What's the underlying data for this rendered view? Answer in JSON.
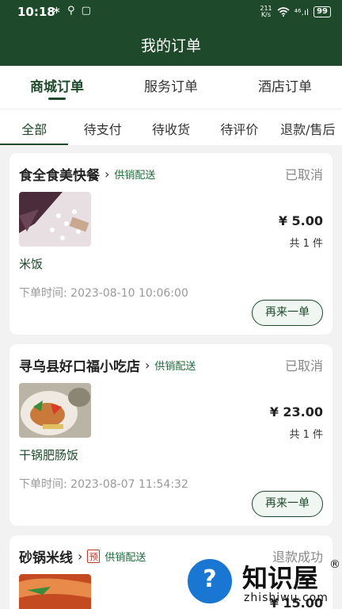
{
  "status_bar": {
    "time": "10:18",
    "left_icons": "∗ ⚲ ▢",
    "net_speed_top": "211",
    "net_speed_bottom": "K/s",
    "signal": "⁴⁶.ıl",
    "battery": "99"
  },
  "header": {
    "title": "我的订单"
  },
  "tabs": [
    {
      "label": "商城订单",
      "active": true
    },
    {
      "label": "服务订单",
      "active": false
    },
    {
      "label": "酒店订单",
      "active": false
    }
  ],
  "filters": [
    {
      "label": "全部",
      "active": true
    },
    {
      "label": "待支付",
      "active": false
    },
    {
      "label": "待收货",
      "active": false
    },
    {
      "label": "待评价",
      "active": false
    },
    {
      "label": "退款/售后",
      "active": false
    }
  ],
  "orders": [
    {
      "shop": "食全食美快餐",
      "chevron": "›",
      "pre_tag": "",
      "delivery": "供销配送",
      "status": "已取消",
      "item_name": "米饭",
      "price": "¥ 5.00",
      "count": "共 1 件",
      "time": "下单时间: 2023-08-10 10:06:00",
      "button": "再来一单"
    },
    {
      "shop": "寻乌县好口福小吃店",
      "chevron": "›",
      "pre_tag": "",
      "delivery": "供销配送",
      "status": "已取消",
      "item_name": "干锅肥肠饭",
      "price": "¥ 23.00",
      "count": "共 1 件",
      "time": "下单时间: 2023-08-07 11:54:32",
      "button": "再来一单"
    },
    {
      "shop": "砂锅米线",
      "chevron": "›",
      "pre_tag": "预",
      "delivery": "供销配送",
      "status": "退款成功",
      "price": "¥ 15.00"
    }
  ],
  "watermark": {
    "brand": "知识屋",
    "reg": "®",
    "url": "zhishiwu.com",
    "icon": "?"
  },
  "colors": {
    "primary": "#1e4a2b",
    "accent_red": "#c0392b"
  }
}
